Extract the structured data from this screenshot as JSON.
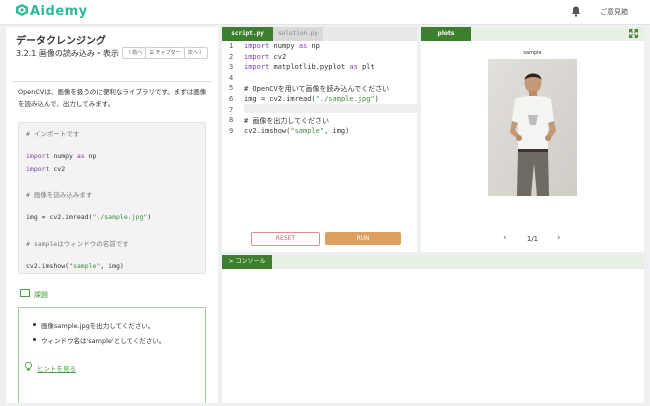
{
  "header": {
    "logo_text": "Aidemy",
    "feedback_label": "ご意見箱"
  },
  "lesson": {
    "title": "データクレンジング",
    "section_title": "3.2.1 画像の読み込み・表示",
    "nav": {
      "prev": "〈 前へ",
      "chapter": "☰ チャプター",
      "next": "次へ 〉"
    },
    "description": "OpenCVは、画像を扱うのに便利なライブラリです。まずは画像を読み込んで、出力してみます。",
    "code_lines": [
      {
        "text": "# インポートです",
        "kind": "comment"
      },
      {
        "text": "",
        "kind": "blank"
      },
      {
        "parts": [
          {
            "t": "import",
            "c": "kw"
          },
          {
            "t": " numpy ",
            "c": ""
          },
          {
            "t": "as",
            "c": "kw"
          },
          {
            "t": " np",
            "c": ""
          }
        ]
      },
      {
        "parts": [
          {
            "t": "import",
            "c": "kw"
          },
          {
            "t": " cv2",
            "c": ""
          }
        ]
      },
      {
        "text": "",
        "kind": "blank"
      },
      {
        "text": "# 画像を読み込みます",
        "kind": "comment"
      },
      {
        "text": "",
        "kind": "blank"
      },
      {
        "parts": [
          {
            "t": "img = cv2.imread(",
            "c": ""
          },
          {
            "t": "\"./sample.jpg\"",
            "c": "st"
          },
          {
            "t": ")",
            "c": ""
          }
        ]
      },
      {
        "text": "",
        "kind": "blank"
      },
      {
        "text": "# sampleはウィンドウの名前です",
        "kind": "comment"
      },
      {
        "text": "",
        "kind": "blank"
      },
      {
        "parts": [
          {
            "t": "cv2.imshow(",
            "c": ""
          },
          {
            "t": "\"sample\"",
            "c": "st"
          },
          {
            "t": ", img)",
            "c": ""
          }
        ]
      }
    ],
    "task_heading": "課題",
    "tasks": [
      "画像sample.jpgを出力してください。",
      "ウィンドウ名は'sample'としてください。"
    ],
    "hint_label": "ヒントを見る"
  },
  "editor": {
    "tabs": [
      "script.py",
      "solution.py"
    ],
    "active_tab": 0,
    "line_numbers": [
      "1",
      "2",
      "3",
      "4",
      "5",
      "6",
      "7",
      "8",
      "9"
    ],
    "lines": [
      {
        "parts": [
          {
            "t": "import",
            "c": "kw"
          },
          {
            "t": " numpy ",
            "c": ""
          },
          {
            "t": "as",
            "c": "kw"
          },
          {
            "t": " np",
            "c": ""
          }
        ]
      },
      {
        "parts": [
          {
            "t": "import",
            "c": "kw"
          },
          {
            "t": " cv2",
            "c": ""
          }
        ]
      },
      {
        "parts": [
          {
            "t": "import",
            "c": "kw"
          },
          {
            "t": " matplotlib.pyplot ",
            "c": ""
          },
          {
            "t": "as",
            "c": "kw"
          },
          {
            "t": " plt",
            "c": ""
          }
        ]
      },
      {
        "parts": []
      },
      {
        "parts": [
          {
            "t": "# OpenCVを用いて画像を読み込んでください",
            "c": "cm"
          }
        ]
      },
      {
        "parts": [
          {
            "t": "img = cv2.imread(",
            "c": ""
          },
          {
            "t": "\"./sample.jpg\"",
            "c": "st"
          },
          {
            "t": ")",
            "c": ""
          }
        ]
      },
      {
        "parts": []
      },
      {
        "parts": [
          {
            "t": "# 画像を出力してください",
            "c": "cm"
          }
        ]
      },
      {
        "parts": [
          {
            "t": "cv2.imshow(",
            "c": ""
          },
          {
            "t": "\"sample\"",
            "c": "st"
          },
          {
            "t": ", img)",
            "c": ""
          }
        ]
      }
    ],
    "reset_label": "RESET",
    "run_label": "RUN"
  },
  "plots": {
    "tab_label": "plots",
    "figure_title": "sample",
    "pager": "1/1",
    "prev_glyph": "‹",
    "next_glyph": "›"
  },
  "console": {
    "tab_label": "> コンソール"
  },
  "colors": {
    "accent_green": "#3d7f2e",
    "logo_teal": "#2fb89a",
    "run_orange": "#dca160",
    "reset_red": "#d46161"
  },
  "icons": [
    "aidemy-logo-icon",
    "bell-icon",
    "book-icon",
    "bulb-icon",
    "expand-icon"
  ]
}
